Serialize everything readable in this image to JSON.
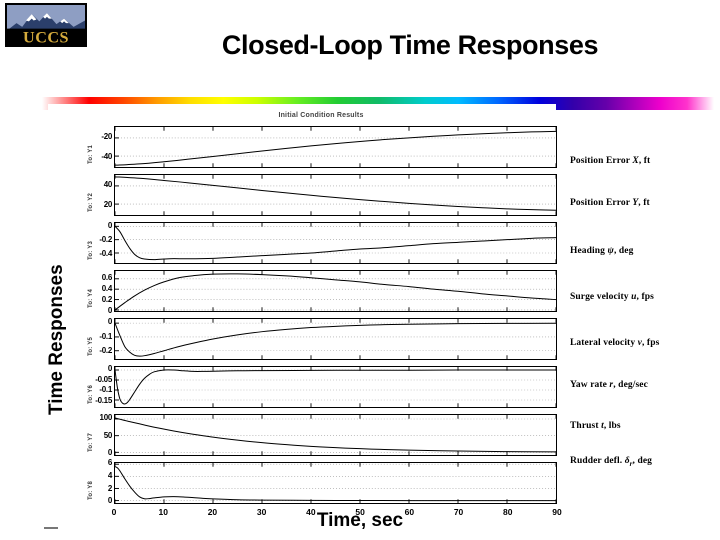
{
  "logo": {
    "name": "UCCS",
    "alt": "UCCS mountain logo"
  },
  "slide": {
    "title": "Closed-Loop Time Responses"
  },
  "figure": {
    "title": "Initial Condition Results",
    "yaxis_title": "Time Responses",
    "xaxis_title": "Time, sec"
  },
  "annotations": [
    "Position Error X, ft",
    "Position Error Y, ft",
    "Heading ψ, deg",
    "Surge velocity u, fps",
    "Lateral velocity v, fps",
    "Yaw rate r, deg/sec",
    "Thrust t, lbs",
    "Rudder defl. δr, deg"
  ],
  "chart_data": {
    "type": "line",
    "title": "Initial Condition Results",
    "xlabel": "Time, sec",
    "ylabel": "Time Responses",
    "xlim": [
      0,
      90
    ],
    "xticks": [
      0,
      10,
      20,
      30,
      40,
      50,
      60,
      70,
      80,
      90
    ],
    "grid": true,
    "legend_position": "right-annotations",
    "panels": [
      {
        "group_label": "To: Y1",
        "annotation": "Position Error X, ft",
        "yticks": [
          -20,
          -40
        ],
        "ylim": [
          -52,
          -8
        ],
        "x": [
          0,
          5,
          10,
          15,
          20,
          25,
          30,
          35,
          40,
          45,
          50,
          55,
          60,
          65,
          70,
          75,
          80,
          85,
          90
        ],
        "y": [
          -50.0,
          -48.6,
          -46.2,
          -43.4,
          -40.4,
          -37.4,
          -34.4,
          -31.5,
          -28.8,
          -26.3,
          -23.9,
          -21.8,
          -19.9,
          -18.2,
          -16.7,
          -15.4,
          -14.3,
          -13.4,
          -12.8
        ]
      },
      {
        "group_label": "To: Y2",
        "annotation": "Position Error Y, ft",
        "yticks": [
          40,
          20
        ],
        "ylim": [
          8,
          52
        ],
        "x": [
          0,
          5,
          10,
          15,
          20,
          25,
          30,
          35,
          40,
          45,
          50,
          55,
          60,
          65,
          70,
          75,
          80,
          85,
          90
        ],
        "y": [
          50.0,
          48.4,
          46.0,
          43.4,
          40.6,
          37.8,
          35.0,
          32.3,
          29.7,
          27.2,
          24.9,
          22.8,
          20.8,
          19.0,
          17.4,
          16.0,
          14.8,
          13.9,
          13.2
        ]
      },
      {
        "group_label": "To: Y3",
        "annotation": "Heading ψ, deg",
        "yticks": [
          0,
          -0.2,
          -0.4
        ],
        "ylim": [
          -0.55,
          0.05
        ],
        "x": [
          0,
          1,
          2,
          3,
          4,
          5,
          6,
          8,
          10,
          12,
          15,
          20,
          25,
          30,
          35,
          40,
          45,
          50,
          55,
          60,
          65,
          70,
          75,
          80,
          85,
          90
        ],
        "y": [
          0.0,
          -0.08,
          -0.21,
          -0.33,
          -0.42,
          -0.47,
          -0.49,
          -0.5,
          -0.49,
          -0.485,
          -0.487,
          -0.48,
          -0.46,
          -0.44,
          -0.42,
          -0.4,
          -0.37,
          -0.34,
          -0.32,
          -0.29,
          -0.26,
          -0.24,
          -0.22,
          -0.2,
          -0.18,
          -0.17
        ]
      },
      {
        "group_label": "To: Y4",
        "annotation": "Surge velocity u, fps",
        "yticks": [
          0.6,
          0.4,
          0.2,
          0
        ],
        "ylim": [
          -0.02,
          0.75
        ],
        "x": [
          0,
          2,
          4,
          6,
          8,
          10,
          13,
          16,
          20,
          25,
          30,
          35,
          40,
          45,
          50,
          55,
          60,
          65,
          70,
          75,
          80,
          85,
          90
        ],
        "y": [
          0.0,
          0.14,
          0.27,
          0.38,
          0.47,
          0.54,
          0.62,
          0.66,
          0.69,
          0.695,
          0.68,
          0.655,
          0.62,
          0.58,
          0.54,
          0.49,
          0.45,
          0.4,
          0.36,
          0.31,
          0.27,
          0.23,
          0.2
        ]
      },
      {
        "group_label": "To: Y5",
        "annotation": "Lateral velocity v, fps",
        "yticks": [
          0,
          -0.1,
          -0.2
        ],
        "ylim": [
          -0.26,
          0.03
        ],
        "x": [
          0,
          1,
          2,
          3,
          4,
          5,
          6,
          8,
          10,
          13,
          16,
          20,
          25,
          30,
          35,
          40,
          45,
          50,
          55,
          60,
          70,
          80,
          90
        ],
        "y": [
          0.0,
          -0.09,
          -0.17,
          -0.21,
          -0.233,
          -0.239,
          -0.236,
          -0.22,
          -0.2,
          -0.17,
          -0.145,
          -0.115,
          -0.085,
          -0.062,
          -0.045,
          -0.032,
          -0.023,
          -0.016,
          -0.011,
          -0.008,
          -0.004,
          -0.002,
          -0.001
        ]
      },
      {
        "group_label": "To: Y6",
        "annotation": "Yaw rate r, deg/sec",
        "yticks": [
          0,
          -0.05,
          -0.1,
          -0.15
        ],
        "ylim": [
          -0.185,
          0.015
        ],
        "x": [
          0,
          0.5,
          1,
          1.5,
          2,
          2.5,
          3,
          4,
          5,
          6,
          7,
          8,
          10,
          12,
          14,
          16,
          18,
          20,
          25,
          30,
          40,
          50,
          60,
          70,
          80,
          90
        ],
        "y": [
          0.0,
          -0.09,
          -0.145,
          -0.165,
          -0.17,
          -0.163,
          -0.148,
          -0.11,
          -0.072,
          -0.042,
          -0.022,
          -0.009,
          0.0,
          0.0,
          -0.004,
          -0.007,
          -0.007,
          -0.006,
          -0.004,
          -0.003,
          -0.002,
          -0.001,
          -0.001,
          0.0,
          0.0,
          0.0
        ]
      },
      {
        "group_label": "To: Y7",
        "annotation": "Thrust t, lbs",
        "yticks": [
          100,
          50,
          0
        ],
        "ylim": [
          -8,
          112
        ],
        "x": [
          0,
          3,
          6,
          9,
          12,
          15,
          20,
          25,
          30,
          35,
          40,
          45,
          50,
          55,
          60,
          70,
          80,
          90
        ],
        "y": [
          103.0,
          92.0,
          82.0,
          72.5,
          64.0,
          56.5,
          45.5,
          36.5,
          29.0,
          23.0,
          18.0,
          14.0,
          11.0,
          8.5,
          6.5,
          4.0,
          2.2,
          1.2
        ]
      },
      {
        "group_label": "To: Y8",
        "annotation": "Rudder defl. δr, deg",
        "yticks": [
          6,
          4,
          2,
          0
        ],
        "ylim": [
          -0.4,
          6.2
        ],
        "x": [
          0,
          0.5,
          1,
          2,
          3,
          4,
          5,
          6,
          7,
          8,
          10,
          12,
          14,
          16,
          18,
          20,
          25,
          30,
          40,
          50,
          60,
          70,
          80,
          90
        ],
        "y": [
          5.6,
          5.4,
          4.9,
          3.6,
          2.4,
          1.4,
          0.62,
          0.3,
          0.33,
          0.45,
          0.62,
          0.66,
          0.6,
          0.48,
          0.36,
          0.28,
          0.14,
          0.08,
          0.03,
          0.01,
          0.0,
          0.0,
          0.0,
          0.0
        ]
      }
    ]
  }
}
